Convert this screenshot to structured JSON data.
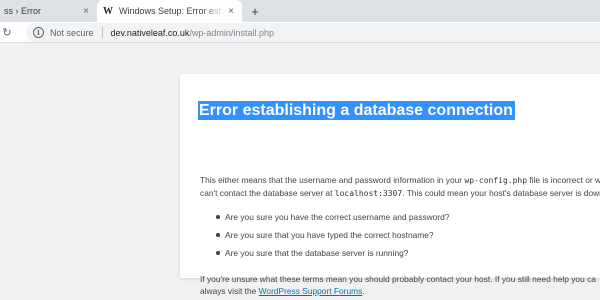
{
  "browser": {
    "tabs": [
      {
        "title": "ss › Error",
        "active": false
      },
      {
        "title": "Windows Setup: Error establishing",
        "favicon": "W",
        "active": true
      }
    ],
    "new_tab_label": "+",
    "close_label": "×",
    "reload_label": "↻",
    "security_label": "Not secure",
    "url_host": "dev.nativeleaf.co.uk",
    "url_path": "/wp-admin/install.php"
  },
  "error_page": {
    "heading": "Error establishing a database connection",
    "para1_line1_a": "This either means that the username and password information in your ",
    "para1_code1": "wp-config.php",
    "para1_line1_b": " file is incorrect or w",
    "para1_line2_a": "can't contact the database server at ",
    "para1_code2": "localhost:3307",
    "para1_line2_b": ". This could mean your host's database server is down",
    "checklist": [
      "Are you sure you have the correct username and password?",
      "Are you sure that you have typed the correct hostname?",
      "Are you sure that the database server is running?"
    ],
    "para2_line1": "If you're unsure what these terms mean you should probably contact your host. If you still need help you ca",
    "para2_line2_a": "always visit the ",
    "para2_link": "WordPress Support Forums",
    "para2_line2_b": "."
  }
}
